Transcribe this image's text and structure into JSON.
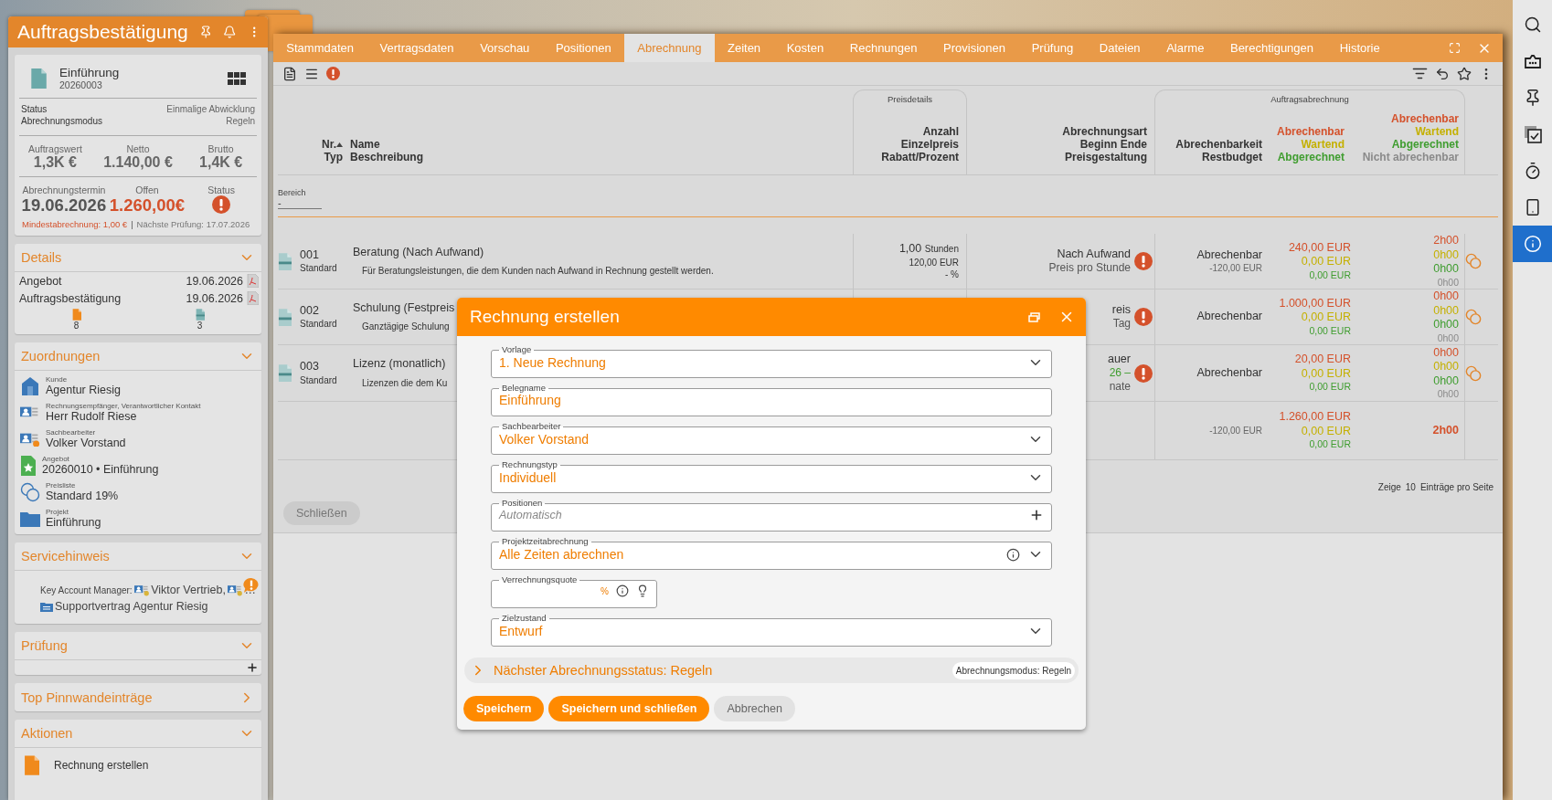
{
  "left_panel": {
    "title": "Auftragsbestätigung",
    "summary": {
      "name": "Einführung",
      "number": "20260003",
      "info": [
        {
          "label": "Status",
          "value": "Einmalige Abwicklung"
        },
        {
          "label": "Abrechnungsmodus",
          "value": "Regeln"
        }
      ],
      "totals": [
        {
          "label": "Auftragswert",
          "value": "1,3K €"
        },
        {
          "label": "Netto",
          "value": "1.140,00 €"
        },
        {
          "label": "Brutto",
          "value": "1,4K €"
        }
      ],
      "billing": [
        {
          "kind": "date",
          "label": "Abrechnungstermin",
          "value": "19.06.2026"
        },
        {
          "kind": "amount",
          "label": "Offen",
          "value": "1.260,00€"
        },
        {
          "kind": "alert",
          "label": "Status"
        }
      ],
      "minimum": "Mindestabrechnung: 1,00 €",
      "separator": "|",
      "next_check": "Nächste Prüfung: 17.07.2026"
    },
    "sections": [
      {
        "kind": "documents",
        "title": "Details",
        "expanded": true,
        "rows": [
          {
            "name": "Angebot",
            "date": "19.06.2026"
          },
          {
            "name": "Auftragsbestätigung",
            "date": "19.06.2026"
          }
        ],
        "counters": [
          {
            "kind": "document",
            "count": "8"
          },
          {
            "kind": "invoice",
            "count": "3"
          }
        ]
      },
      {
        "kind": "assignments",
        "title": "Zuordnungen",
        "expanded": true,
        "items": [
          {
            "kind": "customer",
            "label": "Kunde",
            "value": "Agentur Riesig"
          },
          {
            "kind": "contact",
            "label": "Rechnungsempfänger, Verantwortlicher Kontakt",
            "value": "Herr Rudolf Riese"
          },
          {
            "kind": "employee",
            "label": "Sachbearbeiter",
            "value": "Volker Vorstand"
          },
          {
            "kind": "offer",
            "label": "Angebot",
            "value": "20260010 • Einführung"
          },
          {
            "kind": "pricelist",
            "label": "Preisliste",
            "value": "Standard 19%"
          },
          {
            "kind": "project",
            "label": "Projekt",
            "value": "Einführung"
          }
        ]
      },
      {
        "kind": "service",
        "title": "Servicehinweis",
        "expanded": true,
        "label": "Key Account Manager:",
        "contacts": [
          "Viktor Vertrieb,",
          "…"
        ],
        "contract": "Supportvertrag Agentur Riesig"
      },
      {
        "kind": "check",
        "title": "Prüfung",
        "expanded": true
      },
      {
        "title": "Top Pinnwandeinträge",
        "expanded": false
      },
      {
        "kind": "actions",
        "title": "Aktionen",
        "expanded": true,
        "items": [
          "Rechnung erstellen"
        ]
      }
    ]
  },
  "tabs": [
    {
      "label": "Stammdaten",
      "selected": false
    },
    {
      "label": "Vertragsdaten",
      "selected": false
    },
    {
      "label": "Vorschau",
      "selected": false
    },
    {
      "label": "Positionen",
      "selected": false
    },
    {
      "label": "Abrechnung",
      "selected": true
    },
    {
      "label": "Zeiten",
      "selected": false
    },
    {
      "label": "Kosten",
      "selected": false
    },
    {
      "label": "Rechnungen",
      "selected": false
    },
    {
      "label": "Provisionen",
      "selected": false
    },
    {
      "label": "Prüfung",
      "selected": false
    },
    {
      "label": "Dateien",
      "selected": false
    },
    {
      "label": "Alarme",
      "selected": false
    },
    {
      "label": "Berechtigungen",
      "selected": false
    },
    {
      "label": "Historie",
      "selected": false
    }
  ],
  "table": {
    "header": {
      "nr": "Nr.",
      "sorted": true,
      "type": "Typ",
      "name": "Name",
      "description": "Beschreibung",
      "price_group": "Preisdetails",
      "price": [
        "Anzahl",
        "Einzelpreis",
        "Rabatt/Prozent"
      ],
      "billing_type": [
        "Abrechnungsart",
        "Beginn Ende",
        "Preisgestaltung"
      ],
      "billing_group": "Auftragsabrechnung",
      "billability": [
        "Abrechenbarkeit",
        "Restbudget"
      ],
      "amounts": [
        {
          "text": "Abrechenbar",
          "color": "#d4512b"
        },
        {
          "text": "Wartend",
          "color": "#c4b000"
        },
        {
          "text": "Abgerechnet",
          "color": "#3f9d2f"
        }
      ],
      "hours": [
        {
          "text": "Abrechenbar",
          "color": "#d4512b"
        },
        {
          "text": "Wartend",
          "color": "#c4b000"
        },
        {
          "text": "Abgerechnet",
          "color": "#3f9d2f"
        },
        {
          "text": "Nicht abrechenbar",
          "color": "#8a8a8a"
        }
      ]
    },
    "filter": {
      "label": "Bereich",
      "value": "-"
    },
    "rows": [
      {
        "nr": "001",
        "type": "Standard",
        "name": "Beratung (Nach Aufwand)",
        "description": "Für Beratungsleistungen, die dem Kunden nach Aufwand in Rechnung gestellt werden.",
        "price": {
          "quantity": "1,00",
          "unit": "Stunden",
          "unit_price": "120,00 EUR",
          "discount": "- %"
        },
        "billing_type": [
          {
            "text": "Nach Aufwand",
            "color": "#333333"
          },
          {
            "text": "Preis pro Stunde",
            "color": "#555555"
          }
        ],
        "billability": "Abrechenbar",
        "budget": "-120,00 EUR",
        "amounts": [
          {
            "text": "240,00 EUR",
            "color": "#d4512b"
          },
          {
            "text": "0,00 EUR",
            "color": "#c4b000"
          },
          {
            "text": "0,00 EUR",
            "color": "#3f9d2f"
          }
        ],
        "hours": [
          {
            "text": "2h00",
            "color": "#d4512b"
          },
          {
            "text": "0h00",
            "color": "#c4b000"
          },
          {
            "text": "0h00",
            "color": "#3f9d2f"
          },
          {
            "text": "0h00",
            "color": "#8a8a8a"
          }
        ]
      },
      {
        "nr": "002",
        "type": "Standard",
        "name": "Schulung (Festpreis",
        "description": "Ganztägige Schulung",
        "billing_type": [
          {
            "text": "reis",
            "color": "#333333"
          },
          {
            "text": "Tag",
            "color": "#555555"
          }
        ],
        "billability": "Abrechenbar",
        "amounts": [
          {
            "text": "1.000,00 EUR",
            "color": "#d4512b"
          },
          {
            "text": "0,00 EUR",
            "color": "#c4b000"
          },
          {
            "text": "0,00 EUR",
            "color": "#3f9d2f"
          }
        ],
        "hours": [
          {
            "text": "0h00",
            "color": "#d4512b"
          },
          {
            "text": "0h00",
            "color": "#c4b000"
          },
          {
            "text": "0h00",
            "color": "#3f9d2f"
          },
          {
            "text": "0h00",
            "color": "#8a8a8a"
          }
        ]
      },
      {
        "nr": "003",
        "type": "Standard",
        "name": "Lizenz (monatlich)",
        "description": "Lizenzen die dem Ku",
        "billing_type": [
          {
            "text": "auer",
            "color": "#333333"
          },
          {
            "text": "26 –",
            "color": "#3f9d2f"
          },
          {
            "text": "nate",
            "color": "#555555"
          }
        ],
        "billability": "Abrechenbar",
        "amounts": [
          {
            "text": "20,00 EUR",
            "color": "#d4512b"
          },
          {
            "text": "0,00 EUR",
            "color": "#c4b000"
          },
          {
            "text": "0,00 EUR",
            "color": "#3f9d2f"
          }
        ],
        "hours": [
          {
            "text": "0h00",
            "color": "#d4512b"
          },
          {
            "text": "0h00",
            "color": "#c4b000"
          },
          {
            "text": "0h00",
            "color": "#3f9d2f"
          },
          {
            "text": "0h00",
            "color": "#8a8a8a"
          }
        ]
      }
    ],
    "total": {
      "budget": "-120,00 EUR",
      "amounts": [
        {
          "text": "1.260,00 EUR",
          "color": "#d4512b"
        },
        {
          "text": "0,00 EUR",
          "color": "#c4b000"
        },
        {
          "text": "0,00 EUR",
          "color": "#3f9d2f"
        }
      ],
      "hours": [
        {
          "text": "2h00",
          "color": "#d4512b"
        }
      ]
    },
    "pager": {
      "label": "Zeige",
      "size": "10",
      "suffix": "Einträge pro Seite"
    },
    "close_button": "Schließen"
  },
  "dialog": {
    "title": "Rechnung erstellen",
    "fields": [
      {
        "kind": "select",
        "label": "Vorlage",
        "value": "1. Neue Rechnung"
      },
      {
        "kind": "text",
        "label": "Belegname",
        "value": "Einführung"
      },
      {
        "kind": "select",
        "label": "Sachbearbeiter",
        "value": "Volker Vorstand"
      },
      {
        "kind": "select",
        "label": "Rechnungstyp",
        "value": "Individuell"
      },
      {
        "kind": "add",
        "label": "Positionen",
        "placeholder": "Automatisch"
      },
      {
        "kind": "select_info",
        "label": "Projektzeitabrechnung",
        "value": "Alle Zeiten abrechnen"
      },
      {
        "kind": "percent",
        "label": "Verrechnungsquote",
        "unit": "%"
      },
      {
        "kind": "select",
        "label": "Zielzustand",
        "value": "Entwurf"
      }
    ],
    "next_status": {
      "expanded": false,
      "text": "Nächster Abrechnungsstatus: Regeln",
      "chip": "Abrechnungsmodus: Regeln"
    },
    "buttons": [
      {
        "kind": "primary",
        "label": "Speichern"
      },
      {
        "kind": "primary",
        "label": "Speichern und schließen"
      },
      {
        "kind": "secondary",
        "label": "Abbrechen"
      }
    ]
  },
  "right_sidebar": {
    "items": [
      {
        "kind": "search",
        "selected": false
      },
      {
        "kind": "messages",
        "selected": false
      },
      {
        "kind": "pin",
        "selected": false
      },
      {
        "kind": "tasks",
        "selected": false
      },
      {
        "kind": "timer",
        "selected": false
      },
      {
        "kind": "phone",
        "selected": false
      },
      {
        "kind": "info",
        "selected": true
      }
    ]
  }
}
